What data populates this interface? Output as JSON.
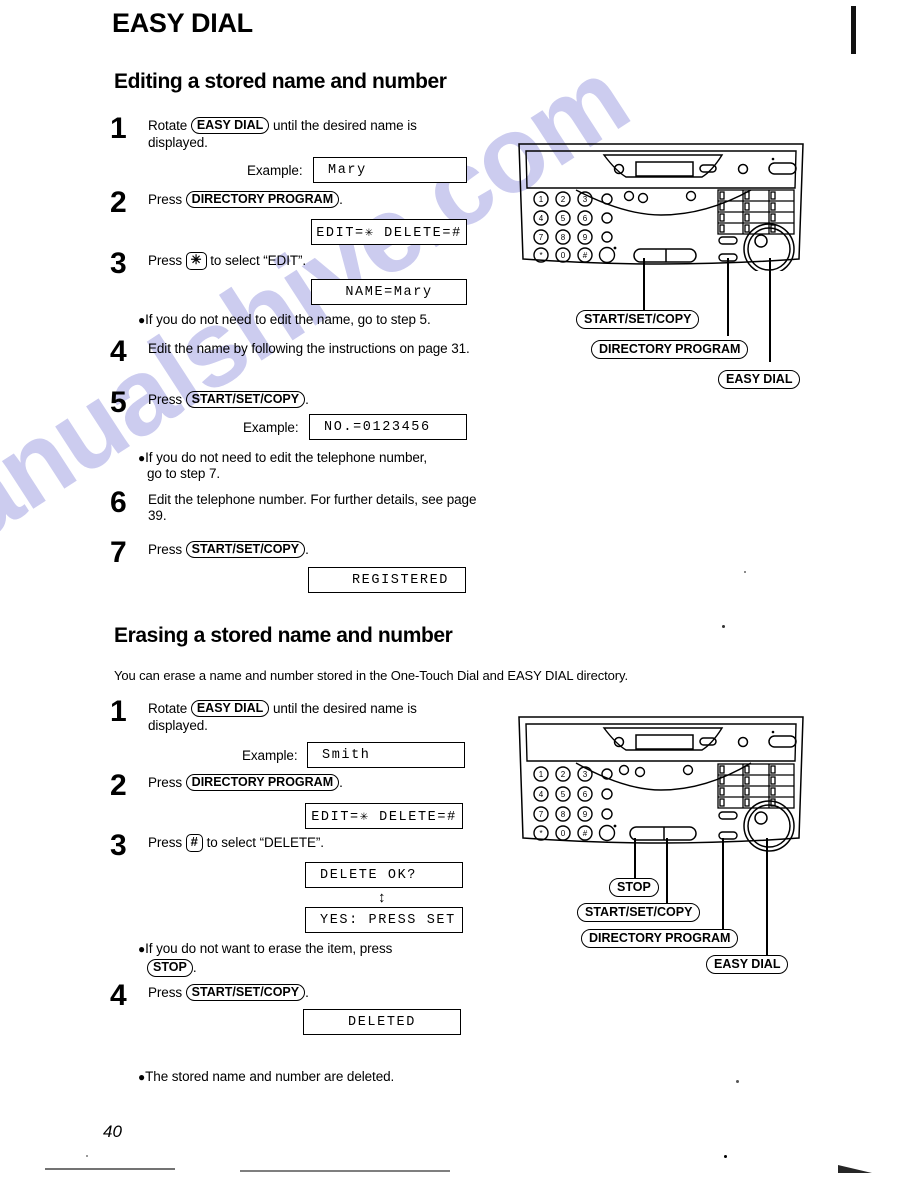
{
  "document": {
    "chapter_title": "EASY DIAL",
    "page_number": "40"
  },
  "watermark": {
    "text": "manualshive.com"
  },
  "section1": {
    "title": "Editing a stored name and number",
    "steps": [
      {
        "number": "1",
        "text_before": "Rotate",
        "key": "EASY DIAL",
        "text_after": "until the desired name is displayed."
      },
      {
        "number": "2",
        "text_before": "Press",
        "key": "DIRECTORY PROGRAM",
        "text_after": "."
      },
      {
        "number": "3",
        "text_before": "Press",
        "key": "✳",
        "text_after": "to select “EDIT”."
      },
      {
        "number": "4",
        "text_before": "Edit the name by following the instructions on page 31.",
        "key": "",
        "text_after": ""
      },
      {
        "number": "5",
        "text_before": "Press",
        "key": "START/SET/COPY",
        "text_after": "."
      },
      {
        "number": "6",
        "text_before": "Edit the telephone number. For further details, see page 39.",
        "key": "",
        "text_after": ""
      },
      {
        "number": "7",
        "text_before": "Press",
        "key": "START/SET/COPY",
        "text_after": "."
      }
    ],
    "example_label_1": "Example:",
    "lcd_name": "Mary",
    "lcd_edit_delete": "EDIT=✳  DELETE=#",
    "lcd_name_mary": "NAME=Mary",
    "bullet_1": "If you do not need to edit the name, go to step 5.",
    "example_label_2": "Example:",
    "lcd_number": "NO.=0123456",
    "bullet_2_line1": "If you do not need to edit the telephone number,",
    "bullet_2_line2": "go to step 7.",
    "lcd_registered": "REGISTERED"
  },
  "section2": {
    "title": "Erasing a stored name and number",
    "intro": "You can erase a name and number stored in the One-Touch Dial and EASY DIAL directory.",
    "steps": [
      {
        "number": "1",
        "text_before": "Rotate",
        "key": "EASY DIAL",
        "text_after": "until the desired name is displayed."
      },
      {
        "number": "2",
        "text_before": "Press",
        "key": "DIRECTORY PROGRAM",
        "text_after": "."
      },
      {
        "number": "3",
        "text_before": "Press",
        "key": "#",
        "text_after": "to select “DELETE”."
      },
      {
        "number": "4",
        "text_before": "Press",
        "key": "START/SET/COPY",
        "text_after": "."
      }
    ],
    "example_label": "Example:",
    "lcd_name": "Smith",
    "lcd_edit_delete": "EDIT=✳  DELETE=#",
    "lcd_delete_ok": "DELETE OK?",
    "lcd_yes_press_set": "YES: PRESS SET",
    "bullet_1_line1": "If you do not want to erase the item, press",
    "bullet_1_key": "STOP",
    "bullet_1_after": ".",
    "lcd_deleted": "DELETED",
    "bullet_2": "The stored name and number are deleted."
  },
  "figure_top": {
    "callouts": [
      "START/SET/COPY",
      "DIRECTORY PROGRAM",
      "EASY DIAL"
    ],
    "keypad_rows": [
      [
        "1",
        "2",
        "3"
      ],
      [
        "4",
        "5",
        "6"
      ],
      [
        "7",
        "8",
        "9"
      ],
      [
        "✳",
        "0",
        "■"
      ]
    ]
  },
  "figure_bottom": {
    "callouts": [
      "STOP",
      "START/SET/COPY",
      "DIRECTORY PROGRAM",
      "EASY DIAL"
    ],
    "keypad_rows": [
      [
        "1",
        "2",
        "3"
      ],
      [
        "4",
        "5",
        "6"
      ],
      [
        "7",
        "8",
        "9"
      ],
      [
        "✳",
        "0",
        "■"
      ]
    ]
  }
}
